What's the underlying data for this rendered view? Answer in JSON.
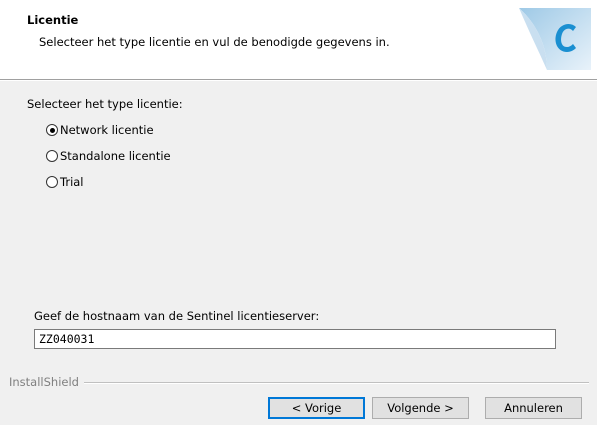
{
  "header": {
    "title": "Licentie",
    "subtitle": "Selecteer het type licentie en vul de benodigde gegevens in.",
    "logo_icon": "installshield-logo-icon"
  },
  "license_type": {
    "label": "Selecteer het type licentie:",
    "options": [
      {
        "label": "Network licentie",
        "checked": true
      },
      {
        "label": "Standalone licentie",
        "checked": false
      },
      {
        "label": "Trial",
        "checked": false
      }
    ]
  },
  "hostname": {
    "label": "Geef de hostnaam van de Sentinel licentieserver:",
    "value": "ZZ040031"
  },
  "footer": {
    "brand": "InstallShield"
  },
  "buttons": {
    "back": "< Vorige",
    "next": "Volgende >",
    "cancel": "Annuleren"
  },
  "colors": {
    "accent": "#0078d7",
    "logo_blue": "#1a8fd1"
  }
}
